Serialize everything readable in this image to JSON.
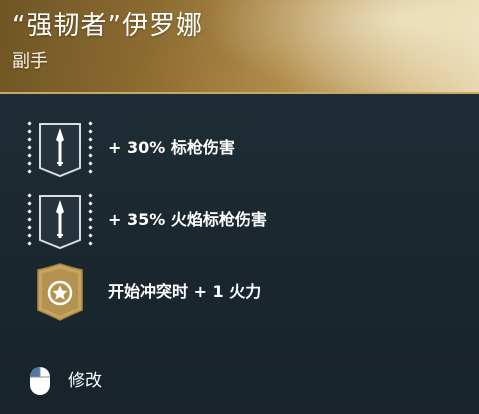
{
  "header": {
    "title": "“强韧者”伊罗娜",
    "subtitle": "副手"
  },
  "perks": [
    {
      "icon": "spear-icon",
      "text": "+ 30% 标枪伤害"
    },
    {
      "icon": "spear-icon",
      "text": "+ 35% 火焰标枪伤害"
    },
    {
      "icon": "star-shield-icon",
      "text": "开始冲突时 + 1 火力"
    }
  ],
  "footer": {
    "modify_label": "修改",
    "icon": "mouse-icon"
  },
  "colors": {
    "header_gold": "#b18d4c",
    "panel_bg": "#1e2a33",
    "badge_gold": "#c8a661",
    "text": "#ffffff"
  }
}
